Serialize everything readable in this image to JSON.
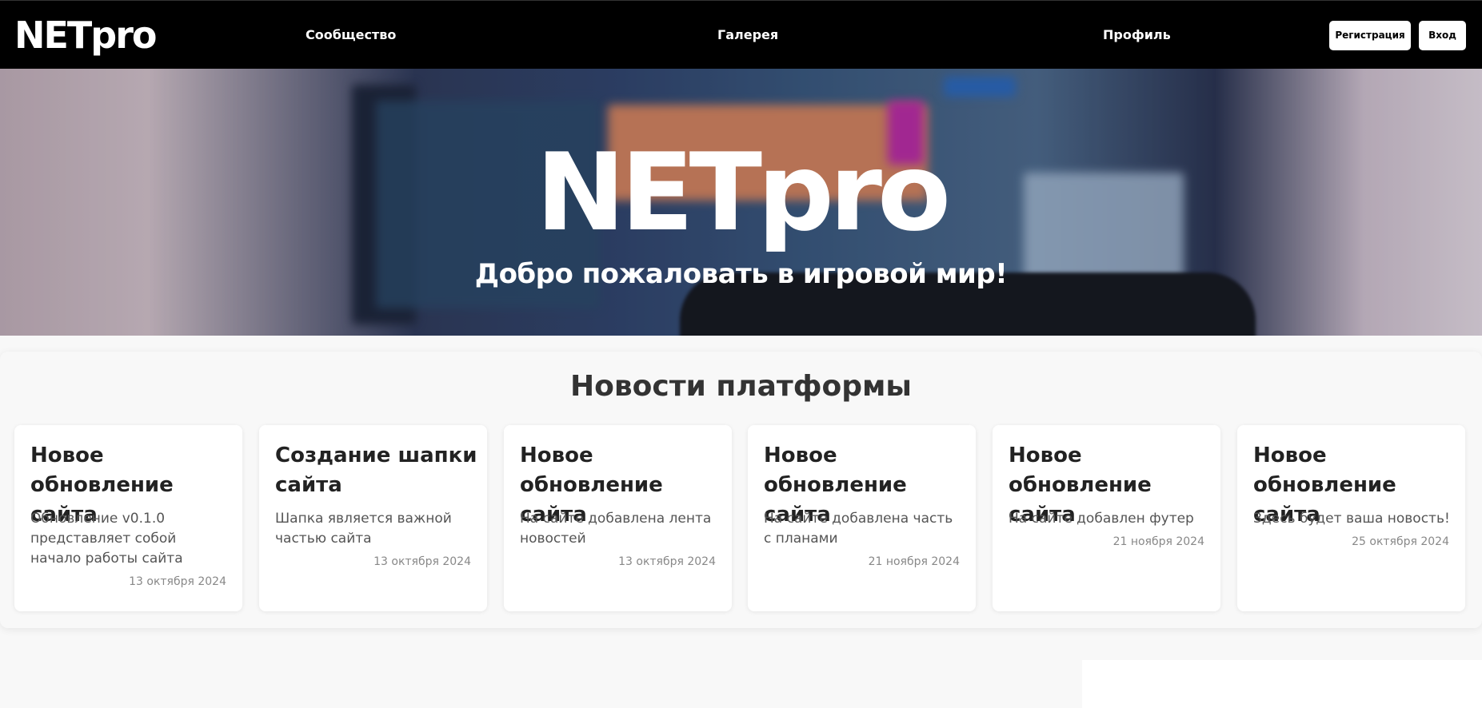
{
  "header": {
    "logo": "NETpro",
    "nav": [
      "Сообщество",
      "Галерея",
      "Профиль"
    ],
    "register_label": "Регистрация",
    "login_label": "Вход"
  },
  "hero": {
    "title": "NETpro",
    "subtitle": "Добро пожаловать в игровой мир!"
  },
  "news": {
    "title": "Новости платформы",
    "cards": [
      {
        "title": "Новое обновление сайта",
        "text": "Обновление v0.1.0 представляет собой начало работы сайта",
        "date": "13 октября 2024"
      },
      {
        "title": "Создание шапки сайта",
        "text": "Шапка является важной частью сайта",
        "date": "13 октября 2024"
      },
      {
        "title": "Новое обновление сайта",
        "text": "На сайте добавлена лента новостей",
        "date": "13 октября 2024"
      },
      {
        "title": "Новое обновление сайта",
        "text": "На сайте добавлена часть с планами",
        "date": "21 ноября 2024"
      },
      {
        "title": "Новое обновление сайта",
        "text": "На сайте добавлен футер",
        "date": "21 ноября 2024"
      },
      {
        "title": "Новое обновление сайта",
        "text": "Здесь будет ваша новость!",
        "date": "25 октября 2024"
      }
    ]
  },
  "colors": {
    "header_bg": "#000000",
    "page_bg": "#f8f8f8",
    "card_bg": "#ffffff"
  }
}
